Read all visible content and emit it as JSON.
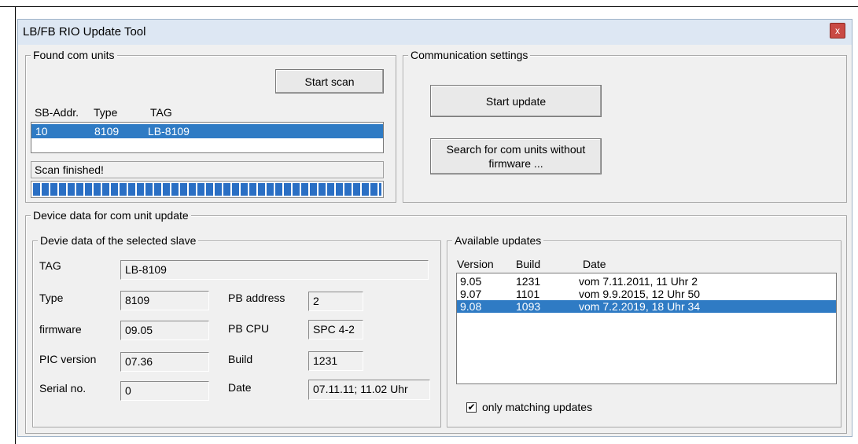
{
  "window": {
    "title": "LB/FB RIO Update Tool",
    "close_label": "x"
  },
  "found_units": {
    "legend": "Found com units",
    "start_scan_label": "Start scan",
    "columns": [
      "SB-Addr.",
      "Type",
      "TAG"
    ],
    "rows": [
      {
        "addr": "10",
        "type": "8109",
        "tag": "LB-8109"
      }
    ],
    "status": "Scan finished!",
    "progress": 1.0
  },
  "comm_settings": {
    "legend": "Communication settings",
    "start_update_label": "Start update",
    "search_label_line1": "Search for com units without",
    "search_label_line2": "firmware ..."
  },
  "device_data": {
    "legend": "Device data for com unit update",
    "slave": {
      "legend": "Devie data of the selected slave",
      "tag_label": "TAG",
      "tag_value": "LB-8109",
      "type_label": "Type",
      "type_value": "8109",
      "firmware_label": "firmware",
      "firmware_value": "09.05",
      "pic_label": "PIC version",
      "pic_value": "07.36",
      "serial_label": "Serial no.",
      "serial_value": "0",
      "pb_address_label": "PB address",
      "pb_address_value": "2",
      "pb_cpu_label": "PB CPU",
      "pb_cpu_value": "SPC 4-2",
      "build_label": "Build",
      "build_value": "1231",
      "date_label": "Date",
      "date_value": "07.11.11; 11.02 Uhr"
    },
    "updates": {
      "legend": "Available updates",
      "columns": [
        "Version",
        "Build",
        "Date"
      ],
      "rows": [
        {
          "version": "9.05",
          "build": "1231",
          "date": "vom 7.11.2011, 11 Uhr 2"
        },
        {
          "version": "9.07",
          "build": "1101",
          "date": "vom 9.9.2015, 12 Uhr 50"
        },
        {
          "version": "9.08",
          "build": "1093",
          "date": "vom 7.2.2019, 18 Uhr 34"
        }
      ],
      "selected_index": 2,
      "only_matching_label": "only matching updates",
      "only_matching_checked": true,
      "check_glyph": "✔"
    }
  },
  "colors": {
    "selection": "#2f7bc4",
    "progress": "#2a6fc4",
    "close": "#c94a44"
  }
}
